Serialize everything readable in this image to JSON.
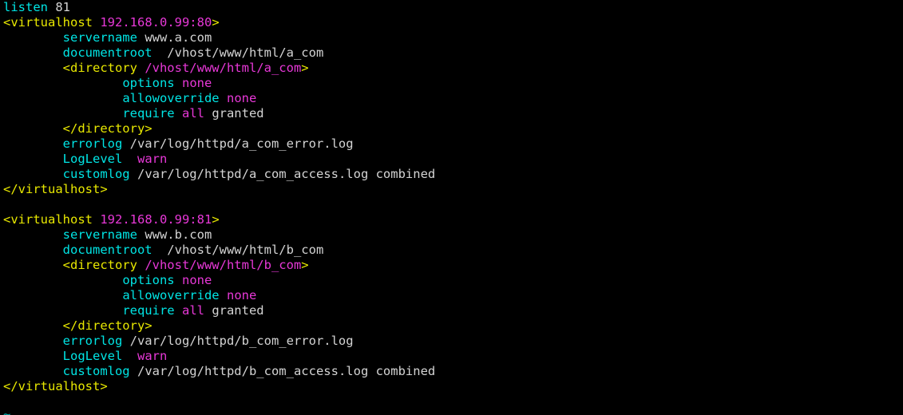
{
  "terminal": {
    "background": "#000000",
    "colors": {
      "tag": "#e8e800",
      "directive": "#00e5e5",
      "value": "#e838d8",
      "plain": "#d4d4d4",
      "tilde": "#00b7b7"
    },
    "filler_glyph": "~",
    "lines": [
      {
        "id": "line-listen",
        "tokens": [
          {
            "t": "listen",
            "c": "c-dir"
          },
          {
            "t": " 81",
            "c": "c-plain"
          }
        ]
      },
      {
        "id": "line-vhost-open-80",
        "tokens": [
          {
            "t": "<virtualhost ",
            "c": "c-tag"
          },
          {
            "t": "192.168.0.99:80",
            "c": "c-val"
          },
          {
            "t": ">",
            "c": "c-tag"
          }
        ]
      },
      {
        "id": "line-servername-a",
        "tokens": [
          {
            "t": "        ",
            "c": "c-plain"
          },
          {
            "t": "servername",
            "c": "c-dir"
          },
          {
            "t": " www.a.com",
            "c": "c-plain"
          }
        ]
      },
      {
        "id": "line-documentroot-a",
        "tokens": [
          {
            "t": "        ",
            "c": "c-plain"
          },
          {
            "t": "documentroot",
            "c": "c-dir"
          },
          {
            "t": "  /vhost/www/html/a_com",
            "c": "c-plain"
          }
        ]
      },
      {
        "id": "line-directory-open-a",
        "tokens": [
          {
            "t": "        ",
            "c": "c-plain"
          },
          {
            "t": "<directory ",
            "c": "c-tag"
          },
          {
            "t": "/vhost/www/html/a_com",
            "c": "c-val"
          },
          {
            "t": ">",
            "c": "c-tag"
          }
        ]
      },
      {
        "id": "line-options-a",
        "tokens": [
          {
            "t": "                ",
            "c": "c-plain"
          },
          {
            "t": "options",
            "c": "c-dir"
          },
          {
            "t": " ",
            "c": "c-plain"
          },
          {
            "t": "none",
            "c": "c-val"
          }
        ]
      },
      {
        "id": "line-allowoverride-a",
        "tokens": [
          {
            "t": "                ",
            "c": "c-plain"
          },
          {
            "t": "allowoverride",
            "c": "c-dir"
          },
          {
            "t": " ",
            "c": "c-plain"
          },
          {
            "t": "none",
            "c": "c-val"
          }
        ]
      },
      {
        "id": "line-require-a",
        "tokens": [
          {
            "t": "                ",
            "c": "c-plain"
          },
          {
            "t": "require",
            "c": "c-dir"
          },
          {
            "t": " ",
            "c": "c-plain"
          },
          {
            "t": "all",
            "c": "c-val"
          },
          {
            "t": " granted",
            "c": "c-plain"
          }
        ]
      },
      {
        "id": "line-directory-close-a",
        "tokens": [
          {
            "t": "        ",
            "c": "c-plain"
          },
          {
            "t": "</directory>",
            "c": "c-tag"
          }
        ]
      },
      {
        "id": "line-errorlog-a",
        "tokens": [
          {
            "t": "        ",
            "c": "c-plain"
          },
          {
            "t": "errorlog",
            "c": "c-dir"
          },
          {
            "t": " /var/log/httpd/a_com_error.log",
            "c": "c-plain"
          }
        ]
      },
      {
        "id": "line-loglevel-a",
        "tokens": [
          {
            "t": "        ",
            "c": "c-plain"
          },
          {
            "t": "LogLevel",
            "c": "c-dir"
          },
          {
            "t": "  ",
            "c": "c-plain"
          },
          {
            "t": "warn",
            "c": "c-val"
          }
        ]
      },
      {
        "id": "line-customlog-a",
        "tokens": [
          {
            "t": "        ",
            "c": "c-plain"
          },
          {
            "t": "customlog",
            "c": "c-dir"
          },
          {
            "t": " /var/log/httpd/a_com_access.log combined",
            "c": "c-plain"
          }
        ]
      },
      {
        "id": "line-vhost-close-80",
        "tokens": [
          {
            "t": "</virtualhost>",
            "c": "c-tag"
          }
        ]
      },
      {
        "id": "line-blank-1",
        "tokens": []
      },
      {
        "id": "line-vhost-open-81",
        "tokens": [
          {
            "t": "<virtualhost ",
            "c": "c-tag"
          },
          {
            "t": "192.168.0.99:81",
            "c": "c-val"
          },
          {
            "t": ">",
            "c": "c-tag"
          }
        ]
      },
      {
        "id": "line-servername-b",
        "tokens": [
          {
            "t": "        ",
            "c": "c-plain"
          },
          {
            "t": "servername",
            "c": "c-dir"
          },
          {
            "t": " www.b.com",
            "c": "c-plain"
          }
        ]
      },
      {
        "id": "line-documentroot-b",
        "tokens": [
          {
            "t": "        ",
            "c": "c-plain"
          },
          {
            "t": "documentroot",
            "c": "c-dir"
          },
          {
            "t": "  /vhost/www/html/b_com",
            "c": "c-plain"
          }
        ]
      },
      {
        "id": "line-directory-open-b",
        "tokens": [
          {
            "t": "        ",
            "c": "c-plain"
          },
          {
            "t": "<directory ",
            "c": "c-tag"
          },
          {
            "t": "/vhost/www/html/b_com",
            "c": "c-val"
          },
          {
            "t": ">",
            "c": "c-tag"
          }
        ]
      },
      {
        "id": "line-options-b",
        "tokens": [
          {
            "t": "                ",
            "c": "c-plain"
          },
          {
            "t": "options",
            "c": "c-dir"
          },
          {
            "t": " ",
            "c": "c-plain"
          },
          {
            "t": "none",
            "c": "c-val"
          }
        ]
      },
      {
        "id": "line-allowoverride-b",
        "tokens": [
          {
            "t": "                ",
            "c": "c-plain"
          },
          {
            "t": "allowoverride",
            "c": "c-dir"
          },
          {
            "t": " ",
            "c": "c-plain"
          },
          {
            "t": "none",
            "c": "c-val"
          }
        ]
      },
      {
        "id": "line-require-b",
        "tokens": [
          {
            "t": "                ",
            "c": "c-plain"
          },
          {
            "t": "require",
            "c": "c-dir"
          },
          {
            "t": " ",
            "c": "c-plain"
          },
          {
            "t": "all",
            "c": "c-val"
          },
          {
            "t": " granted",
            "c": "c-plain"
          }
        ]
      },
      {
        "id": "line-directory-close-b",
        "tokens": [
          {
            "t": "        ",
            "c": "c-plain"
          },
          {
            "t": "</directory>",
            "c": "c-tag"
          }
        ]
      },
      {
        "id": "line-errorlog-b",
        "tokens": [
          {
            "t": "        ",
            "c": "c-plain"
          },
          {
            "t": "errorlog",
            "c": "c-dir"
          },
          {
            "t": " /var/log/httpd/b_com_error.log",
            "c": "c-plain"
          }
        ]
      },
      {
        "id": "line-loglevel-b",
        "tokens": [
          {
            "t": "        ",
            "c": "c-plain"
          },
          {
            "t": "LogLevel",
            "c": "c-dir"
          },
          {
            "t": "  ",
            "c": "c-plain"
          },
          {
            "t": "warn",
            "c": "c-val"
          }
        ]
      },
      {
        "id": "line-customlog-b",
        "tokens": [
          {
            "t": "        ",
            "c": "c-plain"
          },
          {
            "t": "customlog",
            "c": "c-dir"
          },
          {
            "t": " /var/log/httpd/b_com_access.log combined",
            "c": "c-plain"
          }
        ]
      },
      {
        "id": "line-vhost-close-81",
        "tokens": [
          {
            "t": "</virtualhost>",
            "c": "c-tag"
          }
        ]
      }
    ]
  }
}
